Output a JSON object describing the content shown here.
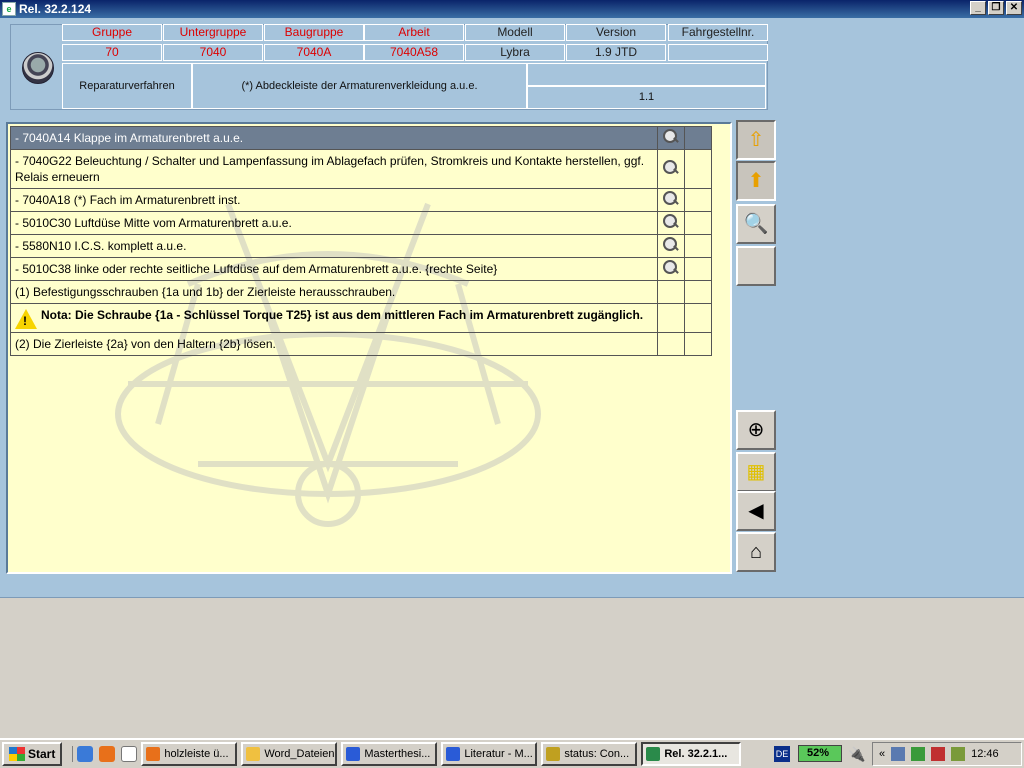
{
  "window": {
    "title": "Rel. 32.2.124",
    "controls": {
      "minimize": "_",
      "restore": "❐",
      "close": "✕"
    }
  },
  "header": {
    "columns": [
      {
        "label": "Gruppe",
        "value": "70",
        "color": "red"
      },
      {
        "label": "Untergruppe",
        "value": "7040",
        "color": "red"
      },
      {
        "label": "Baugruppe",
        "value": "7040A",
        "color": "red"
      },
      {
        "label": "Arbeit",
        "value": "7040A58",
        "color": "red"
      },
      {
        "label": "Modell",
        "value": "Lybra",
        "color": "dark"
      },
      {
        "label": "Version",
        "value": "1.9 JTD",
        "color": "dark"
      },
      {
        "label": "Fahrgestellnr.",
        "value": "",
        "color": "dark"
      }
    ],
    "procedure_label": "Reparaturverfahren",
    "procedure_title": "(*) Abdeckleiste der Armaturenverkleidung a.u.e.",
    "version_number": "1.1"
  },
  "steps": [
    {
      "text": "- 7040A14 Klappe im Armaturenbrett a.u.e.",
      "has_magnifier": true,
      "selected": true,
      "kind": "link"
    },
    {
      "text": "- 7040G22 Beleuchtung / Schalter und Lampenfassung im Ablagefach prüfen, Stromkreis und Kontakte herstellen, ggf. Relais erneuern",
      "has_magnifier": true,
      "selected": false,
      "kind": "link"
    },
    {
      "text": "- 7040A18 (*) Fach im Armaturenbrett inst.",
      "has_magnifier": true,
      "selected": false,
      "kind": "link"
    },
    {
      "text": "- 5010C30 Luftdüse Mitte vom Armaturenbrett a.u.e.",
      "has_magnifier": true,
      "selected": false,
      "kind": "link"
    },
    {
      "text": "- 5580N10 I.C.S. komplett a.u.e.",
      "has_magnifier": true,
      "selected": false,
      "kind": "link"
    },
    {
      "text": "- 5010C38 linke oder rechte seitliche Luftdüse auf dem Armaturenbrett a.u.e.  {rechte Seite}",
      "has_magnifier": true,
      "selected": false,
      "kind": "link"
    },
    {
      "text": "(1) Befestigungsschrauben {1a und 1b} der Zierleiste herausschrauben.",
      "has_magnifier": false,
      "selected": false,
      "kind": "step"
    },
    {
      "text": "Nota: Die Schraube {1a - Schlüssel Torque T25} ist aus dem mittleren Fach im Armaturenbrett zugänglich.",
      "has_magnifier": false,
      "selected": false,
      "kind": "note"
    },
    {
      "text": "(2) Die Zierleiste {2a} von den Haltern {2b} lösen.",
      "has_magnifier": false,
      "selected": false,
      "kind": "step"
    }
  ],
  "sidebar": [
    {
      "name": "page-up-button",
      "icon": "folder-arrow-up-icon",
      "glyph": "⇧"
    },
    {
      "name": "level-up-button",
      "icon": "star-arrow-up-icon",
      "glyph": "⬆"
    },
    {
      "name": "search-button",
      "icon": "magnifier-icon",
      "glyph": "🔍"
    },
    {
      "name": "empty-button",
      "icon": "blank-icon",
      "glyph": ""
    },
    {
      "name": "zoom-button",
      "icon": "zoom-in-icon",
      "glyph": "⊕"
    },
    {
      "name": "parts-button",
      "icon": "parts-icon",
      "glyph": "▦"
    },
    {
      "name": "back-button",
      "icon": "back-triangle-icon",
      "glyph": "◀"
    },
    {
      "name": "home-button",
      "icon": "home-car-icon",
      "glyph": "⌂"
    }
  ],
  "taskbar": {
    "start_label": "Start",
    "tasks": [
      {
        "label": "holzleiste ü...",
        "icon_color": "#e8701a",
        "active": false
      },
      {
        "label": "Word_Dateien",
        "icon_color": "#f0c040",
        "active": false
      },
      {
        "label": "Masterthesi...",
        "icon_color": "#2a5bd7",
        "active": false
      },
      {
        "label": "Literatur - M...",
        "icon_color": "#2a5bd7",
        "active": false
      },
      {
        "label": "status: Con...",
        "icon_color": "#c0a020",
        "active": false
      },
      {
        "label": "Rel. 32.2.1...",
        "icon_color": "#2a8a4a",
        "active": true
      }
    ],
    "language": "DE",
    "battery": "52%",
    "clock": "12:46",
    "tray_chevron": "«"
  },
  "colors": {
    "header_background": "#a6c4dc",
    "content_background": "#ffffcc",
    "selected_row": "#6e7e92",
    "code_red": "#dd0000"
  }
}
